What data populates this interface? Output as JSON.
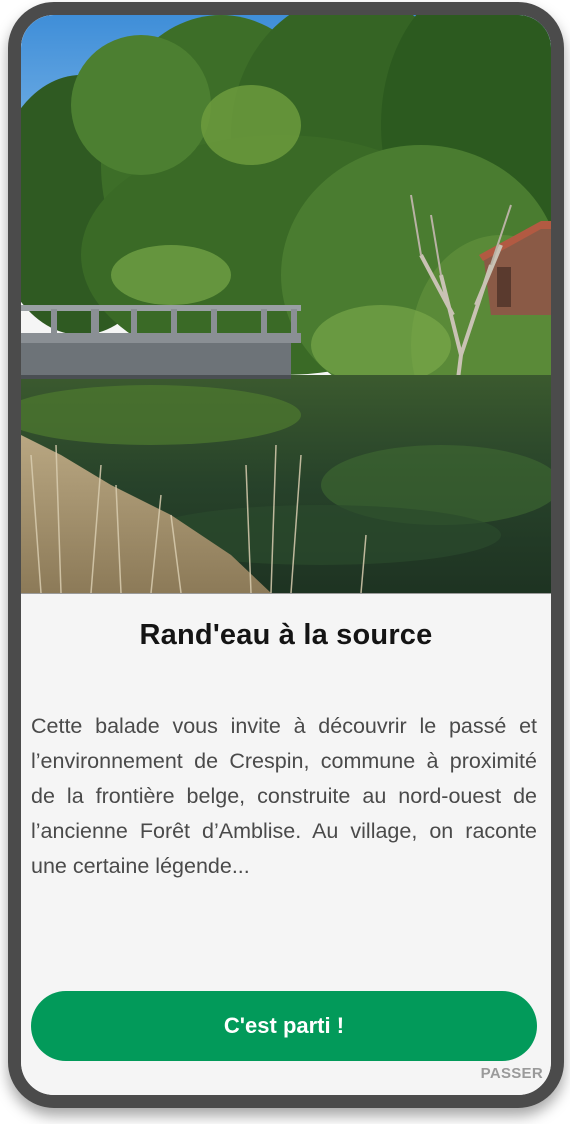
{
  "onboarding": {
    "hero_image_alt": "",
    "title": "Rand'eau à la source",
    "description": "Cette balade vous invite à découvrir le passé et l’environnement de Crespin, commune à proximité de la frontière belge, construite au nord-ouest de l’ancienne Forêt d’Amblise. Au village, on raconte une certaine légende...",
    "cta_label": "C'est parti !",
    "skip_label": "PASSER"
  },
  "colors": {
    "accent": "#029a5a",
    "frame": "#4b4b4b",
    "background": "#f5f5f5",
    "title": "#141414",
    "text": "#4a4a4a",
    "skip": "#9a9a9a"
  },
  "icons": {
    "hero": "river-bridge-photo"
  }
}
